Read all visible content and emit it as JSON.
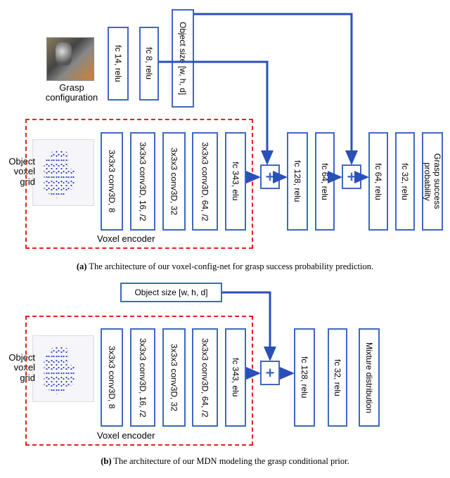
{
  "diagram_a": {
    "caption_bold": "(a)",
    "caption_text": " The architecture of our voxel-config-net for grasp success probability prediction.",
    "grasp_label": "Grasp\nconfiguration",
    "voxel_label": "Object\nvoxel grid",
    "voxel_encoder_label": "Voxel encoder",
    "blocks": {
      "fc14": "fc 14, relu",
      "fc8": "fc 8, relu",
      "objsize": "Object size [w, h, d]",
      "conv1": "3x3x3 conv3D, 8",
      "conv2": "3x3x3 conv3D, 16, /2",
      "conv3": "3x3x3 conv3D, 32",
      "conv4": "3x3x3 conv3D, 64, /2",
      "fc343": "fc 343, elu",
      "fc128": "fc 128, relu",
      "fc64a": "fc 64, relu",
      "fc64b": "fc 64, relu",
      "fc32": "fc 32, relu",
      "out": "Grasp success probability"
    },
    "plus": "+"
  },
  "diagram_b": {
    "caption_bold": "(b)",
    "caption_text": " The architecture of our MDN modeling the grasp conditional prior.",
    "voxel_label": "Object\nvoxel grid",
    "voxel_encoder_label": "Voxel encoder",
    "blocks": {
      "objsize": "Object size [w, h, d]",
      "conv1": "3x3x3 conv3D, 8",
      "conv2": "3x3x3 conv3D, 16, /2",
      "conv3": "3x3x3 conv3D, 32",
      "conv4": "3x3x3 conv3D, 64, /2",
      "fc343": "fc 343, elu",
      "fc128": "fc 128, relu",
      "fc32": "fc 32, relu",
      "out": "Mixture distribution"
    },
    "plus": "+"
  }
}
